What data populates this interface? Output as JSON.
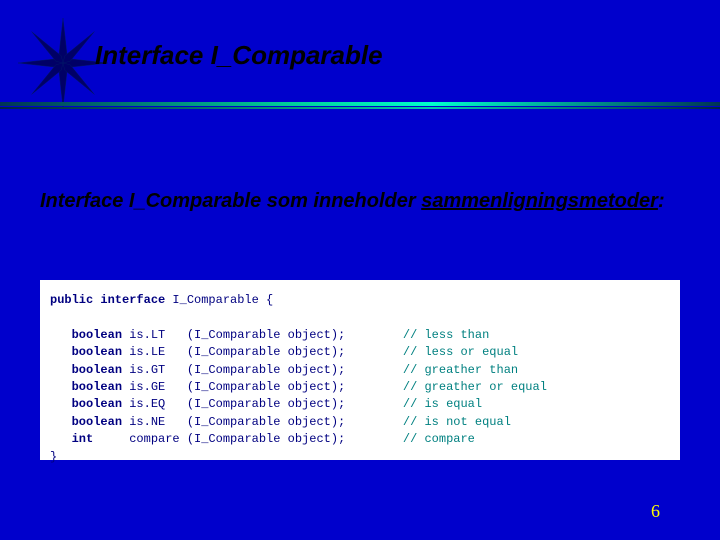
{
  "title": "Interface   I_Comparable",
  "subtitle_prefix": "Interface I_Comparable som inneholder ",
  "subtitle_underlined": "sammenligningsmetoder",
  "subtitle_suffix": ":",
  "code": {
    "decl_kw": "public interface",
    "decl_name": " I_Comparable {",
    "rows": [
      {
        "ret": "boolean",
        "name": "is.LT",
        "sig": "(I_Comparable object);",
        "cm": "// less than"
      },
      {
        "ret": "boolean",
        "name": "is.LE",
        "sig": "(I_Comparable object);",
        "cm": "// less or equal"
      },
      {
        "ret": "boolean",
        "name": "is.GT",
        "sig": "(I_Comparable object);",
        "cm": "// greather than"
      },
      {
        "ret": "boolean",
        "name": "is.GE",
        "sig": "(I_Comparable object);",
        "cm": "// greather or equal"
      },
      {
        "ret": "boolean",
        "name": "is.EQ",
        "sig": "(I_Comparable object);",
        "cm": "// is equal"
      },
      {
        "ret": "boolean",
        "name": "is.NE",
        "sig": "(I_Comparable object);",
        "cm": "// is not equal"
      },
      {
        "ret": "int",
        "name": "compare",
        "sig": "(I_Comparable object);",
        "cm": "// compare"
      }
    ],
    "close": "}"
  },
  "page_number": "6",
  "colors": {
    "slide_bg": "#0000cc",
    "code_text": "#000080",
    "comment": "#008080",
    "pagenum": "#ffff00"
  }
}
